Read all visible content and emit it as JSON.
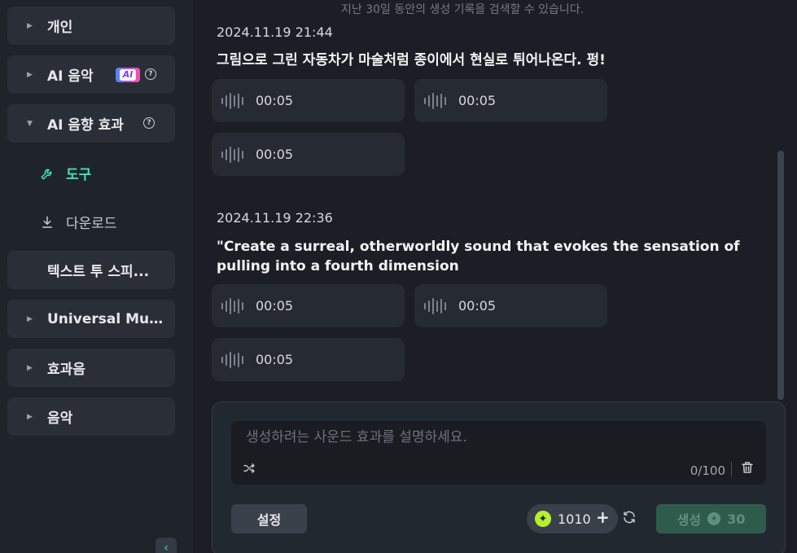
{
  "sidebar": {
    "items": [
      {
        "label": "개인"
      },
      {
        "label": "AI 음악",
        "badge": "AI"
      },
      {
        "label": "AI 음향 효과"
      },
      {
        "label": "텍스트 투 스피..."
      },
      {
        "label": "Universal Mus..."
      },
      {
        "label": "효과음"
      },
      {
        "label": "음악"
      }
    ],
    "sub_items": [
      {
        "label": "도구",
        "icon": "wrench-icon",
        "active": true
      },
      {
        "label": "다운로드",
        "icon": "download-icon",
        "active": false
      }
    ],
    "collapse_icon": "chevron-left-icon"
  },
  "history_hint": "지난 30일 동안의 생성 기록을 검색할 수 있습니다.",
  "history": [
    {
      "timestamp": "2024.11.19 21:44",
      "prompt": "그림으로 그린 자동차가 마술처럼 종이에서 현실로 튀어나온다. 펑!",
      "clips": [
        "00:05",
        "00:05",
        "00:05"
      ]
    },
    {
      "timestamp": "2024.11.19 22:36",
      "prompt": "\"Create a surreal, otherworldly sound that evokes the sensation of pulling into a fourth dimension",
      "clips": [
        "00:05",
        "00:05",
        "00:05"
      ]
    }
  ],
  "composer": {
    "placeholder": "생성하려는 사운드 효과를 설명하세요.",
    "value": "",
    "counter": "0/100",
    "settings_label": "설정",
    "credits": "1010",
    "generate_label": "생성",
    "generate_cost": "30"
  },
  "colors": {
    "accent": "#3fe3b6",
    "credit_coin": "#b4f02e",
    "generate_bg": "#2f5b4c"
  }
}
